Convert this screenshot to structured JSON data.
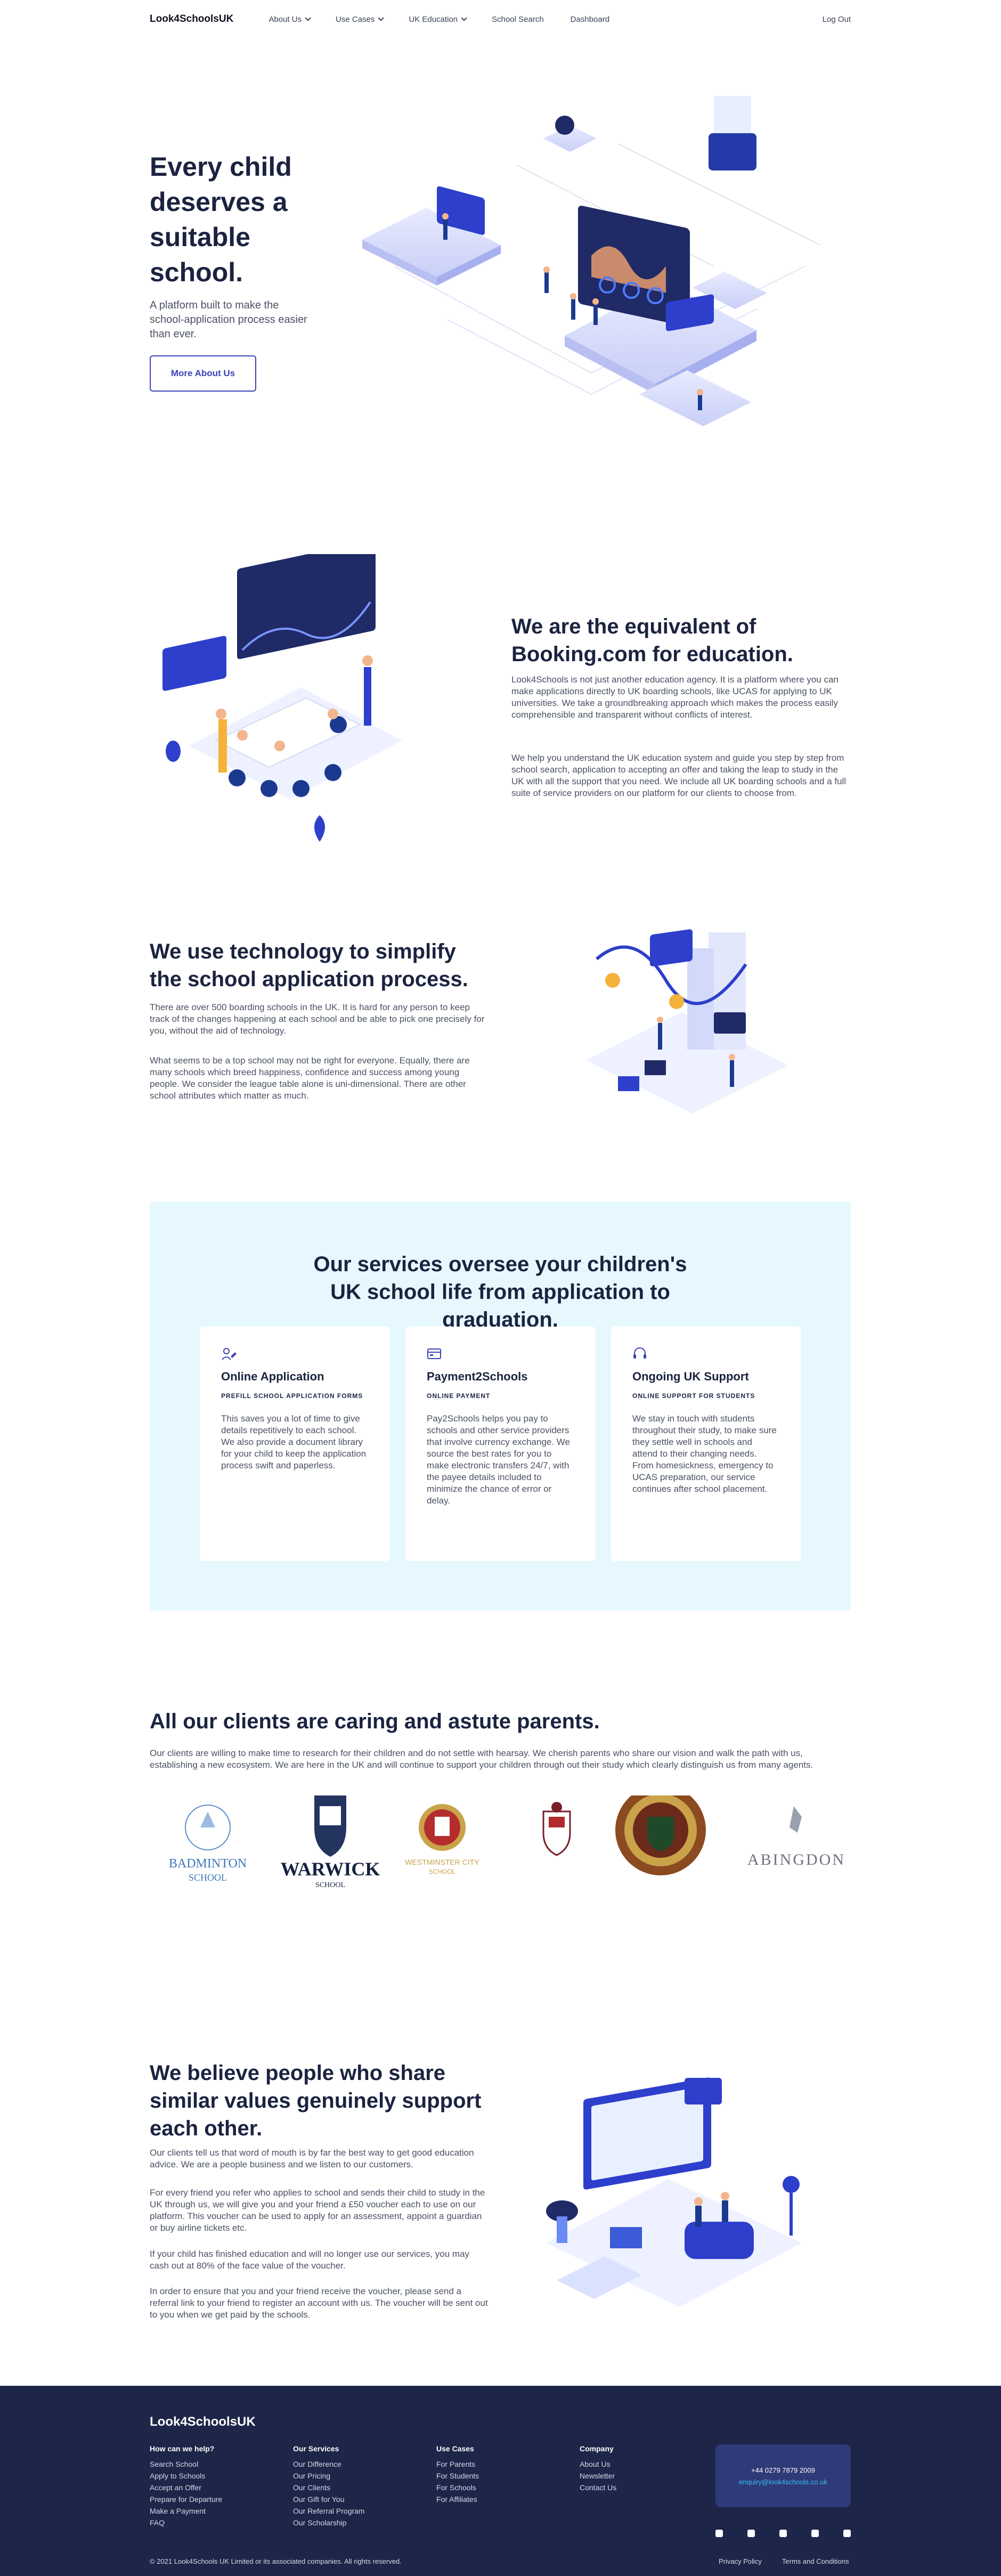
{
  "nav": {
    "logo": "Look4SchoolsUK",
    "items": [
      "About Us",
      "Use Cases",
      "UK Education",
      "School Search",
      "Dashboard"
    ],
    "logout": "Log Out"
  },
  "hero": {
    "title": "Every child deserves a suitable school.",
    "subtitle": "A platform built to make the school-application process easier than ever.",
    "button": "More About Us"
  },
  "equivalent": {
    "title": "We are the equivalent of Booking.com for education.",
    "p1": "Look4Schools is not just another education agency. It is a platform where you can make applications directly to UK boarding schools, like UCAS for applying to UK universities. We take a groundbreaking approach which makes the process easily comprehensible and transparent without conflicts of interest.",
    "p2": "We help you understand the UK education system and guide you step by step from school search, application to accepting an offer and taking the leap to study in the UK with all the support that you need. We include all UK boarding schools and a full suite of service providers on our platform for our clients to choose from."
  },
  "technology": {
    "title": "We use technology to simplify the school application process.",
    "p1": "There are over 500 boarding schools in the UK. It is hard for any person to keep track of the changes happening at each school and be able to pick one precisely for you, without the aid of technology.",
    "p2": "What seems to be a top school may not be right for everyone. Equally, there are many schools which breed happiness, confidence and success among young people. We consider the league table alone is uni-dimensional. There are other school attributes which matter as much."
  },
  "services": {
    "title": "Our services oversee your children's UK school life from application to graduation.",
    "cards": [
      {
        "title": "Online Application",
        "kicker": "PREFILL SCHOOL APPLICATION FORMS",
        "text": "This saves you a lot of time to give details repetitively to each school. We also provide a document library for your child to keep the application process swift and paperless."
      },
      {
        "title": "Payment2Schools",
        "kicker": "ONLINE PAYMENT",
        "text": "Pay2Schools helps you pay to schools and other service providers that involve currency exchange. We source the best rates for you to make electronic transfers 24/7, with the payee details included to minimize the chance of error or delay."
      },
      {
        "title": "Ongoing UK Support",
        "kicker": "ONLINE SUPPORT FOR STUDENTS",
        "text": "We stay in touch with students throughout their study, to make sure they settle well in schools and attend to their changing needs. From homesickness, emergency to UCAS preparation, our service continues after school placement."
      }
    ]
  },
  "clients": {
    "title": "All our clients are caring and astute parents.",
    "text": "Our clients are willing to make time to research for their children and do not settle with hearsay. We cherish parents who share our vision and walk the path with us, establishing a new ecosystem. We are here in the UK and will continue to support your children through out their study which clearly distinguish us from many agents.",
    "logos": {
      "badminton_1": "BADMINTON",
      "badminton_2": "SCHOOL",
      "warwick_1": "WARWICK",
      "warwick_2": "SCHOOL",
      "westminster_1": "WESTMINSTER CITY",
      "westminster_2": "SCHOOL",
      "abingdon": "ABINGDON"
    }
  },
  "values": {
    "title": "We believe people who share similar values genuinely support each other.",
    "p1": "Our clients tell us that word of mouth is by far the best way to get good education advice. We are a people business and we listen to our customers.",
    "p2": "For every friend you refer who applies to school and sends their child to study in the UK through us, we will give you and your friend a £50 voucher each to use on our platform. This voucher can be used to apply for an assessment, appoint a guardian or buy airline tickets etc.",
    "p3": "If your child has finished education and will no longer use our services, you may cash out at 80% of the face value of the voucher.",
    "p4": "In order to ensure that you and your friend receive the voucher, please send a referral link to your friend to register an account with us. The voucher will be sent out to you when we get paid by the schools."
  },
  "footer": {
    "logo": "Look4SchoolsUK",
    "columns": [
      {
        "title": "How can we help?",
        "links": [
          "Search School",
          "Apply to Schools",
          "Accept an Offer",
          "Prepare for Departure",
          "Make a Payment",
          "FAQ"
        ]
      },
      {
        "title": "Our Services",
        "links": [
          "Our Difference",
          "Our Pricing",
          "Our Clients",
          "Our Gift for You",
          "Our Referral Program",
          "Our Scholarship"
        ]
      },
      {
        "title": "Use Cases",
        "links": [
          "For Parents",
          "For Students",
          "For Schools",
          "For Affiliates"
        ]
      },
      {
        "title": "Company",
        "links": [
          "About Us",
          "Newsletter",
          "Contact Us"
        ]
      }
    ],
    "phone": "+44 0279 7879 2009",
    "email": "enquiry@look4schools.co.uk",
    "copyright": "© 2021 Look4Schools UK Limited or its associated companies. All rights reserved.",
    "privacy": "Privacy Policy",
    "terms": "Terms and Conditions",
    "socials": [
      "facebook-icon",
      "instagram-icon",
      "wechat-icon",
      "youtube-icon",
      "twitter-icon"
    ]
  },
  "colors": {
    "brand": "#3b43b7",
    "navy": "#1d2548",
    "light_blue": "#e6f8fe",
    "accent": "#35c1f1"
  }
}
